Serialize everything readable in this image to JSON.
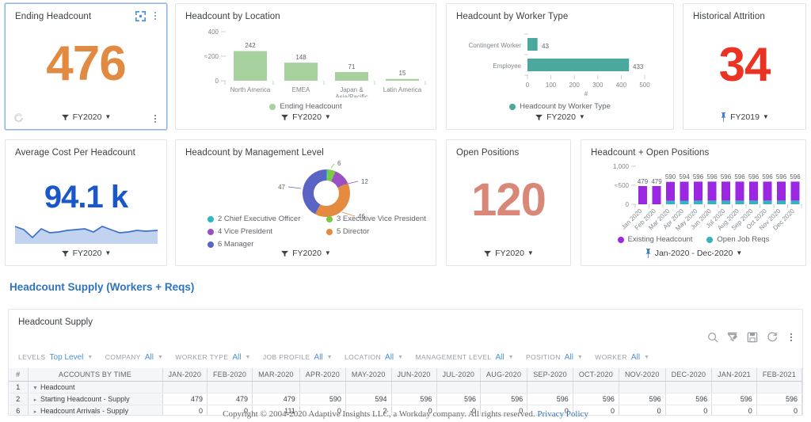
{
  "cards": {
    "ending_headcount": {
      "title": "Ending Headcount",
      "value": "476",
      "color": "#e08a42",
      "period": "FY2020"
    },
    "headcount_by_location": {
      "title": "Headcount by Location",
      "period": "FY2020",
      "legend": "Ending Headcount",
      "legend_color": "#a8d1a0"
    },
    "headcount_by_worker_type": {
      "title": "Headcount by Worker Type",
      "period": "FY2020",
      "legend": "Headcount by Worker Type",
      "legend_color": "#4aa89c",
      "axis_label": "#"
    },
    "historical_attrition": {
      "title": "Historical Attrition",
      "value": "34",
      "color": "#ea3323",
      "period": "FY2019"
    },
    "average_cost_per_headcount": {
      "title": "Average Cost Per Headcount",
      "value": "94.1 k",
      "color": "#1a57c8",
      "period": "FY2020"
    },
    "headcount_by_management_level": {
      "title": "Headcount by Management Level",
      "period": "FY2020"
    },
    "open_positions": {
      "title": "Open Positions",
      "value": "120",
      "color": "#d98878",
      "period": "FY2020"
    },
    "headcount_open_positions": {
      "title": "Headcount + Open Positions",
      "period": "Jan-2020 - Dec-2020"
    }
  },
  "chart_data": [
    {
      "id": "headcount-by-location",
      "type": "bar",
      "title": "Headcount by Location",
      "categories": [
        "North America",
        "EMEA",
        "Japan & Asia/Pacific",
        "Latin America"
      ],
      "values": [
        242,
        148,
        71,
        15
      ],
      "ylim": [
        0,
        400
      ],
      "yticks": [
        0,
        200,
        400
      ],
      "series_name": "Ending Headcount",
      "color": "#a8d1a0",
      "xlabel": "",
      "ylabel": "",
      "legend_position": "bottom",
      "grid": false
    },
    {
      "id": "headcount-by-worker-type",
      "type": "bar",
      "orientation": "horizontal",
      "title": "Headcount by Worker Type",
      "categories": [
        "Contingent Worker",
        "Employee"
      ],
      "values": [
        43,
        433
      ],
      "xlim": [
        0,
        500
      ],
      "xticks": [
        0,
        100,
        200,
        300,
        400,
        500
      ],
      "xlabel": "#",
      "series_name": "Headcount by Worker Type",
      "color": "#4aa89c",
      "legend_position": "bottom",
      "grid": false
    },
    {
      "id": "average-cost-per-headcount-sparkline",
      "type": "area",
      "title": "Average Cost Per Headcount",
      "values": [
        74,
        70,
        52,
        73,
        66,
        68,
        70,
        71,
        72,
        68,
        74,
        70,
        66,
        67,
        69,
        68,
        69
      ],
      "color": "#3d6fd0",
      "fill": "#c2d3ef",
      "grid": false
    },
    {
      "id": "headcount-by-management-level",
      "type": "pie",
      "title": "Headcount by Management Level",
      "labels": [
        "2 Chief Executive Officer",
        "3 Executive Vice President",
        "4 Vice President",
        "5 Director",
        "6 Manager"
      ],
      "values": [
        1,
        6,
        12,
        46,
        47
      ],
      "colors": [
        "#2bb7c4",
        "#7ac943",
        "#9b4fc0",
        "#e58b3f",
        "#5b63c4"
      ],
      "data_labels": [
        "",
        "6",
        "12",
        "46",
        "47"
      ],
      "legend_position": "bottom",
      "donut": true
    },
    {
      "id": "headcount-plus-open-positions",
      "type": "bar",
      "stacked": true,
      "title": "Headcount + Open Positions",
      "categories": [
        "Jan 2020",
        "Feb 2020",
        "Mar 2020",
        "Apr 2020",
        "May 2020",
        "Jun 2020",
        "Jul 2020",
        "Aug 2020",
        "Sep 2020",
        "Oct 2020",
        "Nov 2020",
        "Dec 2020"
      ],
      "series": [
        {
          "name": "Open Job Reqs",
          "color": "#35b3c4",
          "values": [
            0,
            0,
            90,
            94,
            96,
            96,
            96,
            96,
            96,
            96,
            96,
            96
          ]
        },
        {
          "name": "Existing Headcount",
          "color": "#9b27e0",
          "values": [
            479,
            479,
            500,
            500,
            500,
            500,
            500,
            500,
            500,
            500,
            500,
            500
          ]
        }
      ],
      "totals": [
        479,
        479,
        590,
        594,
        596,
        596,
        596,
        596,
        596,
        596,
        596,
        596
      ],
      "ylim": [
        0,
        1000
      ],
      "yticks": [
        0,
        500,
        1000
      ],
      "ytick_labels": [
        "0",
        "500",
        "1,000"
      ],
      "legend_position": "bottom",
      "grid": false
    }
  ],
  "section": {
    "title": "Headcount Supply (Workers + Reqs)"
  },
  "panel": {
    "title": "Headcount Supply",
    "tools": [
      "search-icon",
      "filter-edit-icon",
      "save-icon",
      "refresh-icon",
      "more-icon"
    ],
    "filters": [
      {
        "label": "LEVELS",
        "value": "Top Level"
      },
      {
        "label": "COMPANY",
        "value": "All"
      },
      {
        "label": "WORKER TYPE",
        "value": "All"
      },
      {
        "label": "JOB PROFILE",
        "value": "All"
      },
      {
        "label": "LOCATION",
        "value": "All"
      },
      {
        "label": "MANAGEMENT LEVEL",
        "value": "All"
      },
      {
        "label": "POSITION",
        "value": "All"
      },
      {
        "label": "WORKER",
        "value": "All"
      }
    ],
    "table": {
      "columns": [
        "#",
        "ACCOUNTS BY TIME",
        "JAN-2020",
        "FEB-2020",
        "MAR-2020",
        "APR-2020",
        "MAY-2020",
        "JUN-2020",
        "JUL-2020",
        "AUG-2020",
        "SEP-2020",
        "OCT-2020",
        "NOV-2020",
        "DEC-2020",
        "JAN-2021",
        "FEB-2021"
      ],
      "rows": [
        {
          "num": "1",
          "label": "Headcount",
          "indent": 0,
          "toggle": "expanded",
          "values": [
            "",
            "",
            "",
            "",
            "",
            "",
            "",
            "",
            "",
            "",
            "",
            "",
            "",
            ""
          ]
        },
        {
          "num": "2",
          "label": "Starting Headcount - Supply",
          "indent": 1,
          "toggle": "collapsed",
          "values": [
            "479",
            "479",
            "479",
            "590",
            "594",
            "596",
            "596",
            "596",
            "596",
            "596",
            "596",
            "596",
            "596",
            "596"
          ]
        },
        {
          "num": "6",
          "label": "Headcount Arrivals - Supply",
          "indent": 1,
          "toggle": "collapsed",
          "values": [
            "0",
            "0",
            "111",
            "0",
            "2",
            "0",
            "0",
            "0",
            "0",
            "0",
            "0",
            "0",
            "0",
            "0"
          ]
        }
      ]
    }
  },
  "footer": {
    "copyright": "Copyright © 2004-2020 Adaptive Insights LLC, a Workday company. All rights reserved.",
    "privacy_label": "Privacy Policy"
  }
}
